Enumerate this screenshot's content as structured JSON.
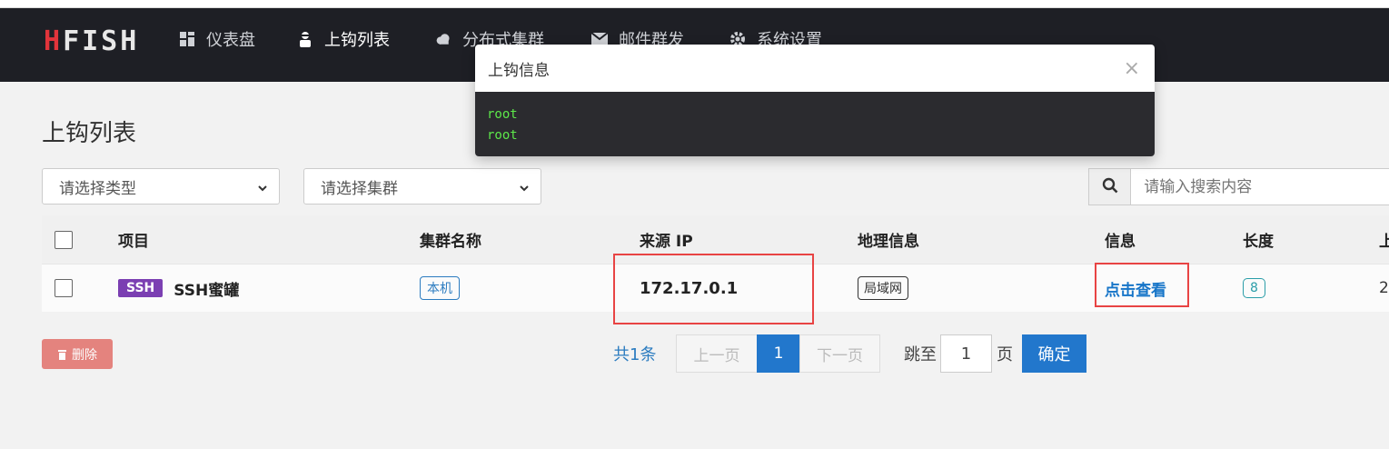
{
  "brand": {
    "logo_text": "FISH",
    "logo_prefix": "H"
  },
  "nav": {
    "items": [
      {
        "label": "仪表盘",
        "icon": "dashboard-icon"
      },
      {
        "label": "上钩列表",
        "icon": "hacker-icon"
      },
      {
        "label": "分布式集群",
        "icon": "cloud-icon"
      },
      {
        "label": "邮件群发",
        "icon": "envelope-icon"
      },
      {
        "label": "系统设置",
        "icon": "gear-icon"
      }
    ]
  },
  "page": {
    "title": "上钩列表"
  },
  "filters": {
    "type_select": "请选择类型",
    "cluster_select": "请选择集群",
    "search_placeholder": "请输入搜索内容"
  },
  "table": {
    "headers": {
      "project": "项目",
      "cluster": "集群名称",
      "source_ip": "来源 IP",
      "geo": "地理信息",
      "info": "信息",
      "length": "长度",
      "time": "上"
    },
    "rows": [
      {
        "badge": "SSH",
        "project": "SSH蜜罐",
        "cluster": "本机",
        "source_ip": "172.17.0.1",
        "geo": "局域网",
        "info": "点击查看",
        "length": "8",
        "time": "2"
      }
    ]
  },
  "actions": {
    "delete_label": "删除"
  },
  "pagination": {
    "total": "共1条",
    "prev": "上一页",
    "current": "1",
    "next": "下一页",
    "jump_to": "跳至",
    "jump_value": "1",
    "page_suffix": "页",
    "confirm": "确定"
  },
  "modal": {
    "title": "上钩信息",
    "close": "×",
    "lines": [
      "root",
      "root"
    ]
  },
  "colors": {
    "nav_bg": "#1e1f25",
    "accent": "#2277cc",
    "logo_red": "#e2343b",
    "highlight_red": "#e84444",
    "console_green": "#5de84a"
  }
}
